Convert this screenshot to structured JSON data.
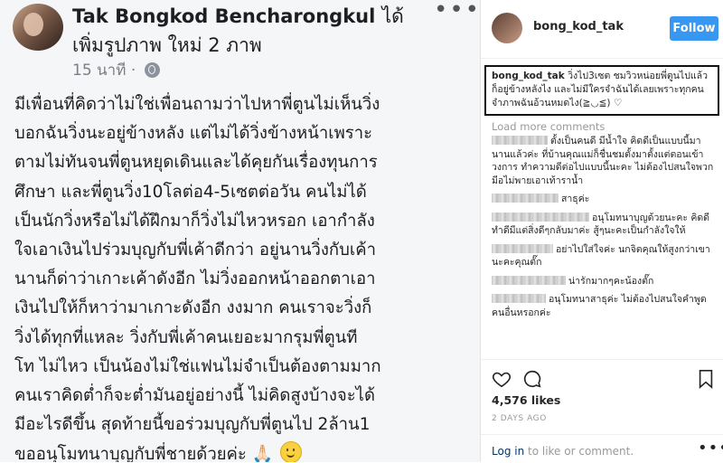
{
  "post": {
    "author": "Tak Bongkod Bencharongkul",
    "author_verb": "ได้",
    "action_line": "เพิ่มรูปภาพ ใหม่ 2 ภาพ",
    "time": "15 นาที ·",
    "menu_glyph": "•••",
    "body_lines": [
      "มีเพื่อนที่คิดว่าไม่ใช่เพื่อนถามว่าไปหาพี่ตูนไม่เห็นวิ่ง",
      "บอกฉันวิ่งนะอยู่ข้างหลัง แต่ไม่ได้วิ่งข้างหน้าเพราะ",
      "ตามไม่ทันจนพี่ตูนหยุดเดินและได้คุยกันเรื่องทุนการ",
      "ศึกษา และพี่ตูนวิ่ง10โลต่อ4-5เซตต่อวัน คนไม่ได้",
      "เป็นนักวิ่งหรือไม่ได้ฝึกมาก็วิ่งไม่ไหวหรอก เอากำลัง",
      "ใจเอาเงินไปร่วมบุญกับพี่เค้าดีกว่า อยู่นานวิ่งกับเค้า",
      "นานก็ด่าว่าเกาะเค้าดังอีก ไม่วิ่งออกหน้าออกตาเอา",
      "เงินไปให้ก็หาว่ามาเกาะดังอีก งงมาก คนเราจะวิ่งก็",
      "วิ่งได้ทุกที่แหละ วิ่งกับพี่เค้าคนเยอะมากรุมพี่ตูนที",
      "โท ไม่ไหว เป็นน้องไม่ใช่แฟนไม่จำเป็นต้องตามมาก",
      "คนเราคิดต่ำก็จะต่ำมันอยู่อย่างนี้ ไม่คิดสูงบ้างจะได้",
      "มีอะไรดีขึ้น สุดท้ายนี้ขอร่วมบุญกับพี่ตูนไป 2ล้าน1"
    ],
    "body_last": "ขออนุโมทนาบุญกับพี่ชายด้วยค่ะ",
    "emoji_pray": "🙏🏻"
  },
  "instagram": {
    "username": "bong_kod_tak",
    "follow_label": "Follow",
    "caption_user": "bong_kod_tak",
    "caption_text": "วิ่งไป3เซต ชมวิวหน่อยพี่ตูนไปแล้วก็อยู่ข้างหลังไง และไม่มีใครจำฉันได้เลยเพราะทุกคนจำภาพฉันอ้วนหมดไง(≧◡≦) ♡",
    "load_more": "Load more comments",
    "comments": [
      {
        "text": "ตั้งเป็นคนดี มีน้ำใจ คิดดีเป็นแบบนี้มานานแล้วค่ะ ที่บ้านคุณแม่ก็ชื่นชมตั้งมาตั้งแต่ตอนเข้าวงการ ทำความดีต่อไปแบบนี้นะคะ ไม่ต้องไปสนใจพวกมีอไม่พายเอาเท้าราน้ำ"
      },
      {
        "text": "สาธุค่ะ"
      },
      {
        "text": "อนุโมทนาบุญด้วยนะคะ คิดดีทำดีมีแต่สิ่งดีๆกลับมาค่ะ สู้ๆนะคะเป็นกำลังใจให้"
      },
      {
        "text": "อย่าไปใส่ใจค่ะ นกจิตคุณให้สูงกว่าเขานะคะคุณตั๊ก"
      },
      {
        "text": "น่ารักมากๆคะน้องตั๊ก"
      },
      {
        "text": "อนุโมทนาสาธุค่ะ ไม่ต้องไปสนใจคำพูดคนอื่นหรอกค่ะ"
      }
    ],
    "likes": "4,576 likes",
    "date": "2 DAYS AGO",
    "login_link": "Log in",
    "login_rest": " to like or comment.",
    "more_glyph": "•••"
  }
}
